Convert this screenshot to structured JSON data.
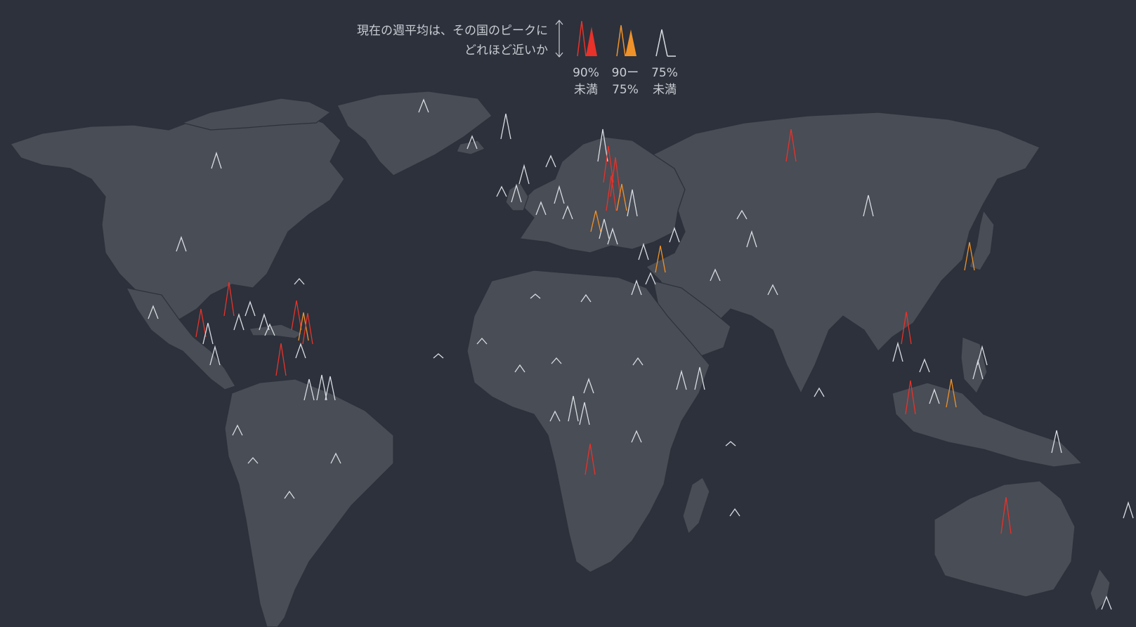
{
  "legend": {
    "title_line1": "現在の週平均は、その国のピークに",
    "title_line2": "どれほど近いか",
    "items": [
      {
        "line1": "90%",
        "line2": "未満",
        "color": "#e8322a",
        "category": "high"
      },
      {
        "line1": "90ー",
        "line2": "75%",
        "color": "#f0922a",
        "category": "mid"
      },
      {
        "line1": "75%",
        "line2": "未満",
        "color": "#d9dce2",
        "category": "low"
      }
    ]
  },
  "colors": {
    "background": "#2c313b",
    "land": "#494d55",
    "high": "#e8322a",
    "mid": "#f0922a",
    "low": "#d9dce2"
  }
}
